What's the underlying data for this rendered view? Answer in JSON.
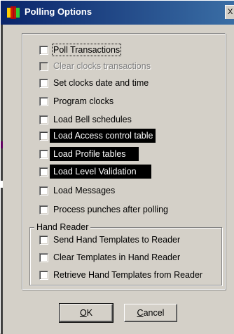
{
  "window": {
    "title": "Polling Options",
    "close_glyph": "X"
  },
  "options": [
    {
      "label": "Poll Transactions",
      "checked": false,
      "disabled": false,
      "focused": true
    },
    {
      "label": "Clear clocks transactions",
      "checked": false,
      "disabled": true
    },
    {
      "label": "Set clocks date and time",
      "checked": false,
      "disabled": false
    },
    {
      "label": "Program clocks",
      "checked": false,
      "disabled": false
    },
    {
      "label": "Load Bell schedules",
      "checked": false,
      "disabled": false
    },
    {
      "label": "Load Access control table",
      "checked": false,
      "disabled": false,
      "highlighted": true
    },
    {
      "label": "Load Profile tables",
      "checked": false,
      "disabled": false,
      "highlighted": true
    },
    {
      "label": "Load Level Validation",
      "checked": false,
      "disabled": false,
      "highlighted": true
    },
    {
      "label": "Load Messages",
      "checked": false,
      "disabled": false
    },
    {
      "label": "Process punches after polling",
      "checked": false,
      "disabled": false
    }
  ],
  "hand_reader": {
    "title": "Hand Reader",
    "options": [
      {
        "label": "Send Hand Templates to Reader",
        "checked": false
      },
      {
        "label": "Clear Templates in Hand Reader",
        "checked": false
      },
      {
        "label": "Retrieve Hand Templates from Reader",
        "checked": false
      }
    ]
  },
  "buttons": {
    "ok_accel": "O",
    "ok_rest": "K",
    "cancel_accel": "C",
    "cancel_rest": "ancel"
  }
}
